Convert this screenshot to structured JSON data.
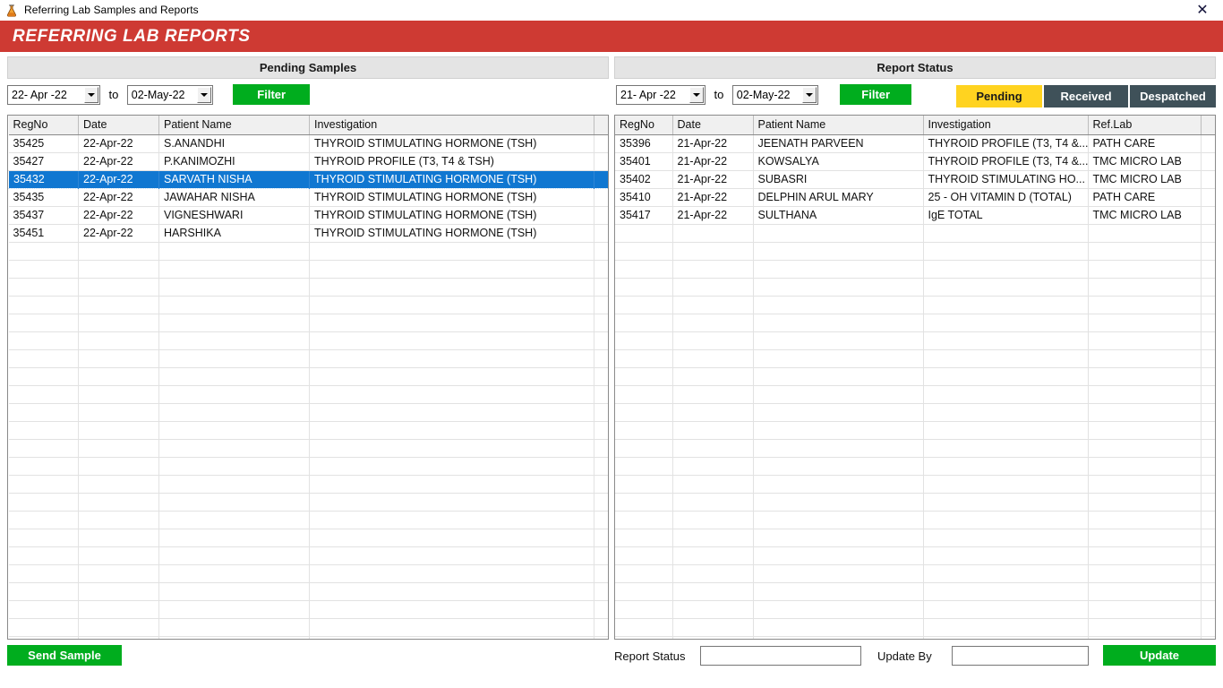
{
  "window": {
    "title": "Referring Lab Samples and Reports",
    "icon": "flask-icon",
    "close_label": "✕"
  },
  "banner": {
    "title": "REFERRING LAB REPORTS",
    "color": "#ce3a33"
  },
  "left_panel": {
    "heading": "Pending Samples",
    "filter": {
      "from_date": "22- Apr -22",
      "to_label": "to",
      "to_date": "02-May-22",
      "button_label": "Filter",
      "button_color": "#00ad1e"
    },
    "columns": [
      "RegNo",
      "Date",
      "Patient Name",
      "Investigation"
    ],
    "rows": [
      {
        "regno": "35425",
        "date": "22-Apr-22",
        "patient": "S.ANANDHI",
        "investigation": "THYROID STIMULATING HORMONE (TSH)",
        "selected": false
      },
      {
        "regno": "35427",
        "date": "22-Apr-22",
        "patient": "P.KANIMOZHI",
        "investigation": "THYROID PROFILE (T3, T4 & TSH)",
        "selected": false
      },
      {
        "regno": "35432",
        "date": "22-Apr-22",
        "patient": "SARVATH NISHA",
        "investigation": "THYROID STIMULATING HORMONE (TSH)",
        "selected": true
      },
      {
        "regno": "35435",
        "date": "22-Apr-22",
        "patient": "JAWAHAR NISHA",
        "investigation": "THYROID STIMULATING HORMONE (TSH)",
        "selected": false
      },
      {
        "regno": "35437",
        "date": "22-Apr-22",
        "patient": "VIGNESHWARI",
        "investigation": "THYROID STIMULATING HORMONE (TSH)",
        "selected": false
      },
      {
        "regno": "35451",
        "date": "22-Apr-22",
        "patient": "HARSHIKA",
        "investigation": "THYROID STIMULATING HORMONE (TSH)",
        "selected": false
      }
    ],
    "empty_rows": 24,
    "selection_color": "#1077d1"
  },
  "right_panel": {
    "heading": "Report Status",
    "filter": {
      "from_date": "21- Apr -22",
      "to_label": "to",
      "to_date": "02-May-22",
      "button_label": "Filter",
      "button_color": "#00ad1e"
    },
    "status_tabs": [
      {
        "label": "Pending",
        "state": "active",
        "color": "#ffd320"
      },
      {
        "label": "Received",
        "state": "idle",
        "color": "#3f5159"
      },
      {
        "label": "Despatched",
        "state": "idle",
        "color": "#3f5159"
      }
    ],
    "columns": [
      "RegNo",
      "Date",
      "Patient Name",
      "Investigation",
      "Ref.Lab"
    ],
    "rows": [
      {
        "regno": "35396",
        "date": "21-Apr-22",
        "patient": "JEENATH PARVEEN",
        "investigation": "THYROID PROFILE (T3, T4 &...",
        "reflab": "PATH CARE"
      },
      {
        "regno": "35401",
        "date": "21-Apr-22",
        "patient": "KOWSALYA",
        "investigation": "THYROID PROFILE (T3, T4 &...",
        "reflab": "TMC MICRO LAB"
      },
      {
        "regno": "35402",
        "date": "21-Apr-22",
        "patient": "SUBASRI",
        "investigation": "THYROID STIMULATING HO...",
        "reflab": "TMC MICRO LAB"
      },
      {
        "regno": "35410",
        "date": "21-Apr-22",
        "patient": "DELPHIN ARUL MARY",
        "investigation": "25 - OH VITAMIN D (TOTAL)",
        "reflab": "PATH CARE"
      },
      {
        "regno": "35417",
        "date": "21-Apr-22",
        "patient": "SULTHANA",
        "investigation": "IgE TOTAL",
        "reflab": "TMC MICRO LAB"
      }
    ],
    "empty_rows": 25
  },
  "footer": {
    "send_sample_label": "Send Sample",
    "report_status_label": "Report Status",
    "report_status_value": "",
    "update_by_label": "Update By",
    "update_by_value": "",
    "update_label": "Update"
  }
}
